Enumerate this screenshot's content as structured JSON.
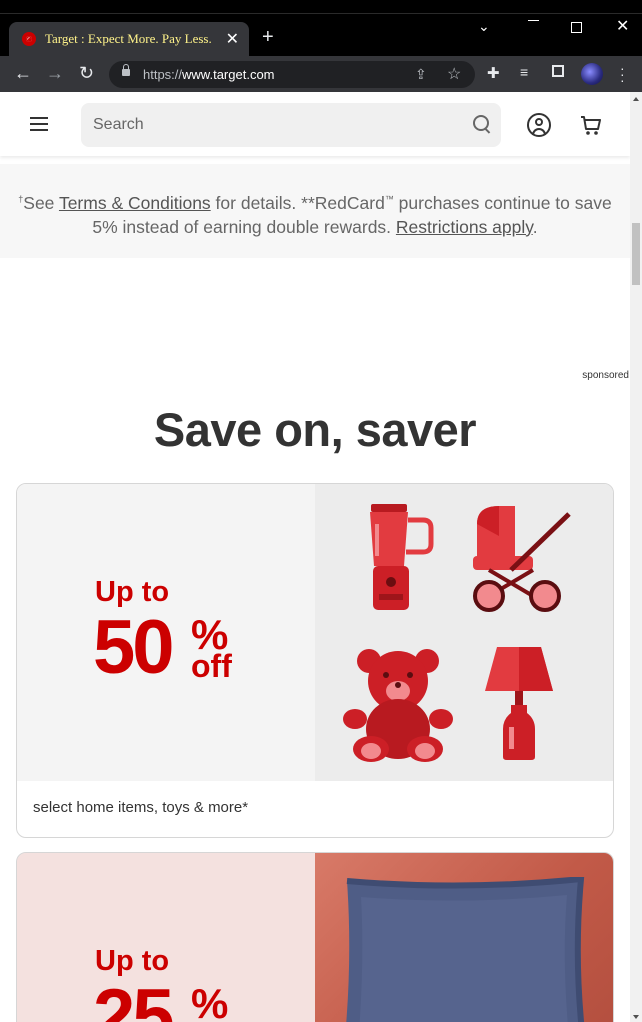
{
  "browser": {
    "tab_title": "Target : Expect More. Pay Less.",
    "url_prefix": "https://",
    "url_host": "www.target.com",
    "colors": {
      "tab_title": "#fff38a",
      "frame": "#000000",
      "toolbar": "#35363a"
    }
  },
  "header": {
    "search_placeholder": "Search",
    "icons": [
      "menu-icon",
      "search-icon",
      "account-icon",
      "cart-icon"
    ]
  },
  "notice": {
    "dagger": "†",
    "see": "See ",
    "terms_link": "Terms & Conditions",
    "mid": " for details. **RedCard",
    "tm": "™",
    "rest": " purchases continue to save 5% instead of earning double rewards. ",
    "restrictions_link": "Restrictions apply",
    "end": "."
  },
  "sponsored": "sponsored",
  "section_heading": "Save on, saver",
  "promos": [
    {
      "up_to": "Up to",
      "percent": "50",
      "percent_sign": "%",
      "off": "off",
      "caption": "select home items, toys & more*",
      "images": [
        "blender-icon",
        "stroller-icon",
        "teddy-bear-icon",
        "lamp-icon"
      ]
    },
    {
      "up_to": "Up to",
      "percent": "25",
      "percent_sign": "%",
      "images": [
        "pillow-image"
      ]
    }
  ],
  "colors": {
    "brand_red": "#cc0000",
    "text": "#333333"
  }
}
